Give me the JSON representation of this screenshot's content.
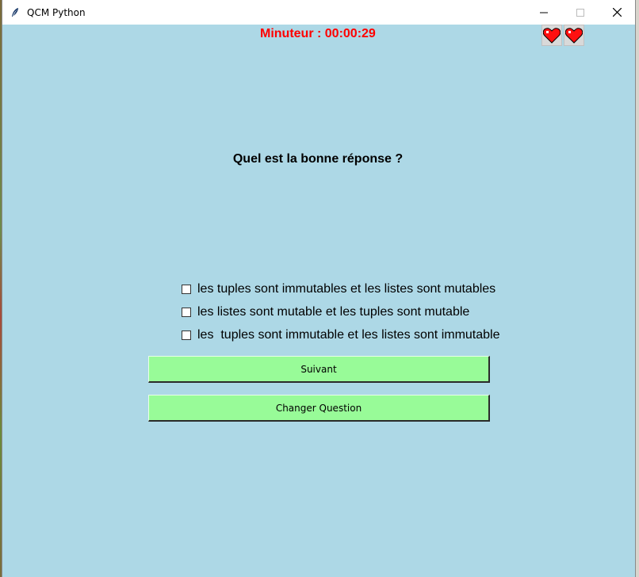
{
  "window": {
    "title": "QCM Python",
    "background_color": "#add8e6",
    "controls": [
      "minimize",
      "maximize",
      "close"
    ]
  },
  "timer": {
    "text": "Minuteur : 00:00:29",
    "color": "#ff0000"
  },
  "lives": {
    "count": 2,
    "icon": "heart-icon"
  },
  "question": {
    "text": "Quel est la bonne réponse ?"
  },
  "options": [
    {
      "label": "les tuples sont immutables et les listes sont mutables",
      "checked": false
    },
    {
      "label": "les listes sont mutable et les tuples sont mutable",
      "checked": false
    },
    {
      "label": "les  tuples sont immutable et les listes sont immutable",
      "checked": false
    }
  ],
  "buttons": {
    "next_label": "Suivant",
    "change_label": "Changer Question",
    "color": "#98fb98"
  }
}
